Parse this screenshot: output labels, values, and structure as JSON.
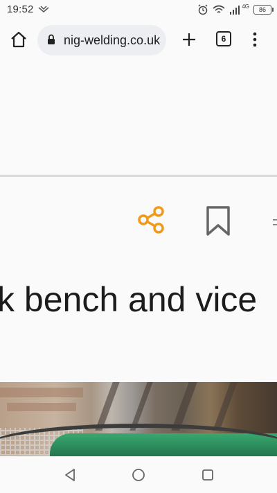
{
  "status_bar": {
    "time": "19:52",
    "network_label": "4G",
    "battery_level": "86"
  },
  "browser": {
    "url": "nig-welding.co.uk",
    "tab_count": "6"
  },
  "page": {
    "heading": "k bench and vice"
  },
  "colors": {
    "share_accent": "#f09a1a",
    "background": "#fafafa"
  },
  "icons": [
    "home-icon",
    "lock-icon",
    "plus-icon",
    "tabs-icon",
    "menu-icon",
    "share-icon",
    "bookmark-icon",
    "back-icon",
    "circle-home-icon",
    "recents-icon"
  ]
}
